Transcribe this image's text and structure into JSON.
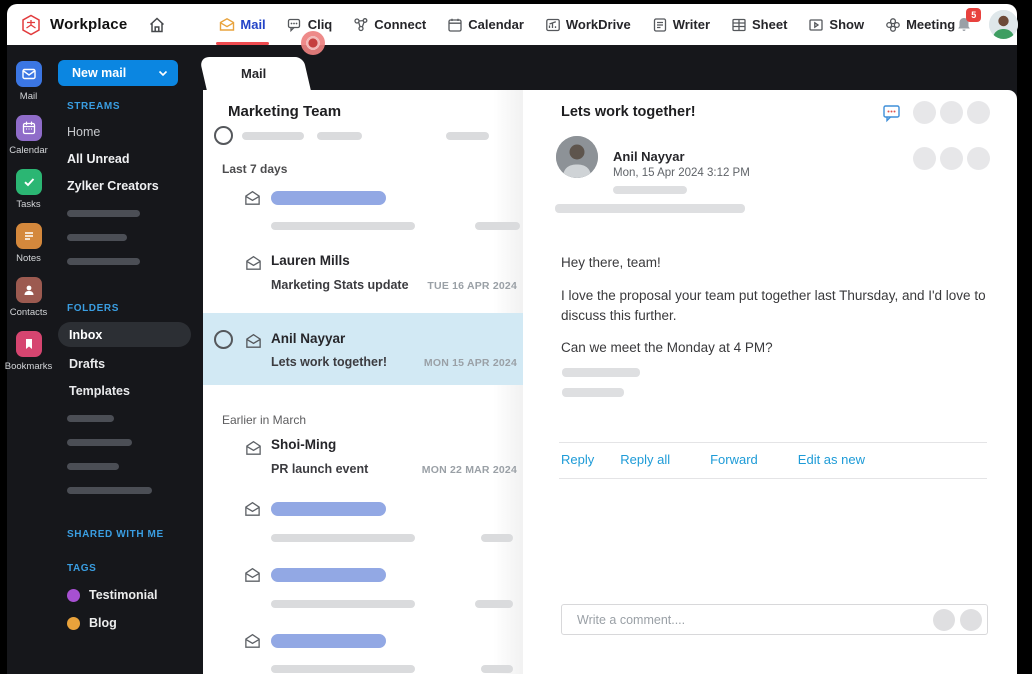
{
  "topbar": {
    "brand": "Workplace",
    "nav_items": [
      {
        "label": "Mail",
        "icon": "mail-icon",
        "active": true
      },
      {
        "label": "Cliq",
        "icon": "cliq-icon"
      },
      {
        "label": "Connect",
        "icon": "connect-icon"
      },
      {
        "label": "Calendar",
        "icon": "calendar-icon"
      },
      {
        "label": "WorkDrive",
        "icon": "workdrive-icon"
      },
      {
        "label": "Writer",
        "icon": "writer-icon"
      },
      {
        "label": "Sheet",
        "icon": "sheet-icon"
      },
      {
        "label": "Show",
        "icon": "show-icon"
      },
      {
        "label": "Meeting",
        "icon": "meeting-icon"
      }
    ],
    "notification_count": "5",
    "active_color": "#2243c7",
    "underline_color": "#ee4b50"
  },
  "app_rail": {
    "items": [
      {
        "label": "Mail",
        "icon": "mail-app-icon",
        "color": "#3b76e3"
      },
      {
        "label": "Calendar",
        "icon": "calendar-app-icon",
        "color": "#8f6cc9"
      },
      {
        "label": "Tasks",
        "icon": "tasks-app-icon",
        "color": "#2bb673"
      },
      {
        "label": "Notes",
        "icon": "notes-app-icon",
        "color": "#d4883c"
      },
      {
        "label": "Contacts",
        "icon": "contacts-app-icon",
        "color": "#9c5a50"
      },
      {
        "label": "Bookmarks",
        "icon": "bookmarks-app-icon",
        "color": "#d64570"
      }
    ]
  },
  "sidebar": {
    "new_mail_label": "New mail",
    "streams_label": "STREAMS",
    "streams": [
      {
        "label": "Home"
      },
      {
        "label": "All Unread"
      },
      {
        "label": "Zylker Creators"
      }
    ],
    "folders_label": "FOLDERS",
    "folders": [
      {
        "label": "Inbox",
        "selected": true
      },
      {
        "label": "Drafts"
      },
      {
        "label": "Templates"
      }
    ],
    "shared_label": "SHARED WITH ME",
    "tags_label": "TAGS",
    "tags": [
      {
        "label": "Testimonial",
        "color": "#a750d2"
      },
      {
        "label": "Blog",
        "color": "#e9a23b"
      }
    ]
  },
  "mail_list": {
    "tab_label": "Mail",
    "title": "Marketing Team",
    "group_labels": [
      "Last 7 days",
      "Earlier in March"
    ],
    "emails": [
      {
        "sender": "Lauren Mills",
        "subject": "Marketing Stats update",
        "date": "TUE 16 APR 2024"
      },
      {
        "sender": "Anil Nayyar",
        "subject": "Lets work together!",
        "date": "MON 15 APR 2024",
        "selected": true
      },
      {
        "sender": "Shoi-Ming",
        "subject": "PR launch event",
        "date": "MON 22 MAR 2024"
      }
    ],
    "selected_bg": "#d2e9f4"
  },
  "reading_pane": {
    "subject": "Lets work together!",
    "sender_name": "Anil Nayyar",
    "sent_datetime": "Mon, 15 Apr 2024  3:12 PM",
    "body_paragraphs": [
      "Hey there, team!",
      "I love the proposal your team put together last Thursday, and I'd love to discuss this further.",
      "Can we meet the Monday at 4 PM?"
    ],
    "actions": [
      {
        "label": "Reply"
      },
      {
        "label": "Reply all"
      },
      {
        "label": "Forward"
      },
      {
        "label": "Edit as new"
      }
    ],
    "comment_placeholder": "Write a comment....",
    "link_color": "#1e9bd7"
  }
}
